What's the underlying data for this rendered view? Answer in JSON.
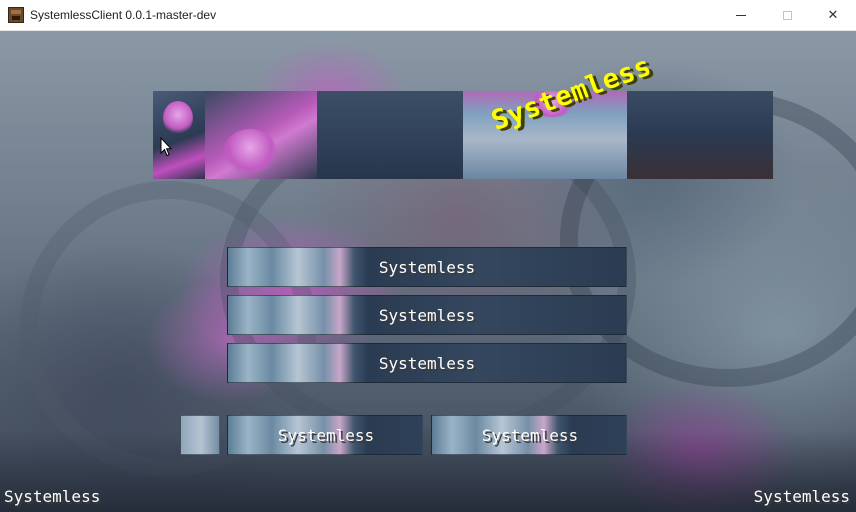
{
  "window": {
    "title": "SystemlessClient 0.0.1-master-dev",
    "controls": {
      "minimize": "minimize",
      "maximize": "maximize",
      "close": "✕"
    }
  },
  "logo": {
    "icon": "banner-image",
    "splash": "Systemless"
  },
  "menu": {
    "button1": "Systemless",
    "button2": "Systemless",
    "button3": "Systemless",
    "button_small_icon": "language-icon",
    "button4": "Systemless",
    "button5": "Systemless"
  },
  "footer": {
    "left": "Systemless",
    "right": "Systemless"
  },
  "colors": {
    "splash": "#ffff00",
    "button_text": "#ffffff",
    "text_shadow": "#3a3a3a"
  }
}
